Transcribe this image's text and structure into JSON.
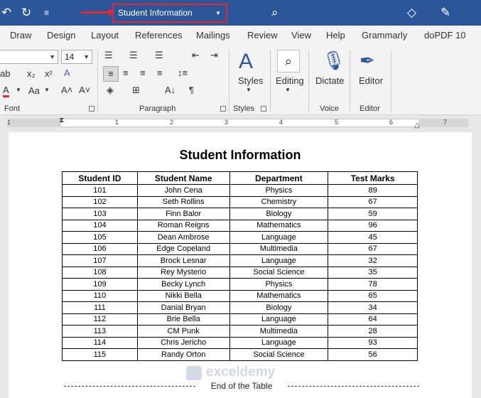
{
  "titlebar": {
    "doc_title": "Student Information"
  },
  "ribbon_tabs": [
    "Draw",
    "Design",
    "Layout",
    "References",
    "Mailings",
    "Review",
    "View",
    "Help",
    "Grammarly",
    "doPDF 10"
  ],
  "font_group": {
    "size_value": "14",
    "label": "Font"
  },
  "paragraph_group": {
    "label": "Paragraph"
  },
  "styles_group": {
    "button_label": "Styles",
    "label": "Styles"
  },
  "editing_group": {
    "button_label": "Editing"
  },
  "voice_group": {
    "button_label": "Dictate",
    "label": "Voice"
  },
  "editor_group": {
    "button_label": "Editor",
    "label": "Editor"
  },
  "ruler": {
    "numbers": [
      "1",
      "1",
      "2",
      "3",
      "4",
      "5",
      "6",
      "7"
    ]
  },
  "document": {
    "title": "Student Information",
    "table": {
      "headers": [
        "Student ID",
        "Student Name",
        "Department",
        "Test Marks"
      ],
      "rows": [
        [
          "101",
          "John Cena",
          "Physics",
          "89"
        ],
        [
          "102",
          "Seth Rollins",
          "Chemistry",
          "67"
        ],
        [
          "103",
          "Finn Balor",
          "Biology",
          "59"
        ],
        [
          "104",
          "Roman Reigns",
          "Mathematics",
          "96"
        ],
        [
          "105",
          "Dean Ambrose",
          "Language",
          "45"
        ],
        [
          "106",
          "Edge Copeland",
          "Multimedia",
          "67"
        ],
        [
          "107",
          "Brock Lesnar",
          "Language",
          "32"
        ],
        [
          "108",
          "Rey Mysterio",
          "Social Science",
          "35"
        ],
        [
          "109",
          "Becky Lynch",
          "Physics",
          "78"
        ],
        [
          "110",
          "Nikki Bella",
          "Mathematics",
          "65"
        ],
        [
          "111",
          "Danial Bryan",
          "Biology",
          "34"
        ],
        [
          "112",
          "Brie Bella",
          "Language",
          "64"
        ],
        [
          "113",
          "CM Punk",
          "Multimedia",
          "28"
        ],
        [
          "114",
          "Chris Jericho",
          "Language",
          "93"
        ],
        [
          "115",
          "Randy Orton",
          "Social Science",
          "56"
        ]
      ]
    },
    "footer_text": "End of the Table",
    "watermark": "exceldemy"
  },
  "colors": {
    "title_bar": "#2b579a",
    "highlight": "#e8262c"
  }
}
